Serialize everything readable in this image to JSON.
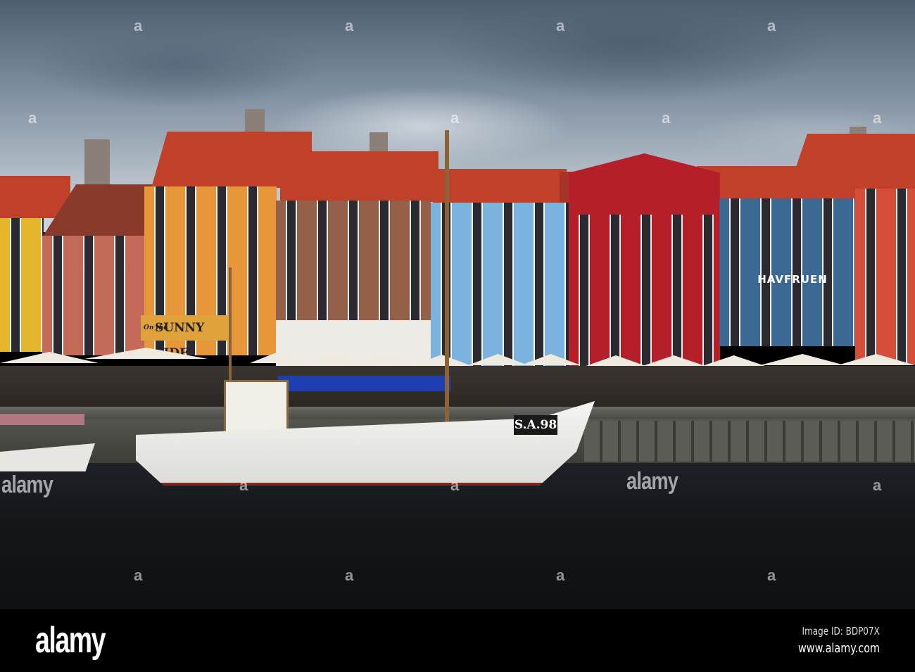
{
  "signs": {
    "sunny_side_prefix": "On the",
    "sunny_side": "SUNNY SIDE",
    "havfruen": "HAVFRUEN",
    "boat_registration": "S.A.98"
  },
  "watermark": {
    "logo": "alamy",
    "letter": "a",
    "image_id": "Image ID: BDP07X",
    "url": "www.alamy.com"
  },
  "colors": {
    "yellow_house": "#e6b52e",
    "salmon_house": "#c46a58",
    "orange_house": "#e8963a",
    "brick_house": "#94604a",
    "blue_house": "#7cb2de",
    "red_house": "#b51f2a",
    "dark_blue_house": "#3c6894",
    "orange_red_house": "#d64e38"
  }
}
